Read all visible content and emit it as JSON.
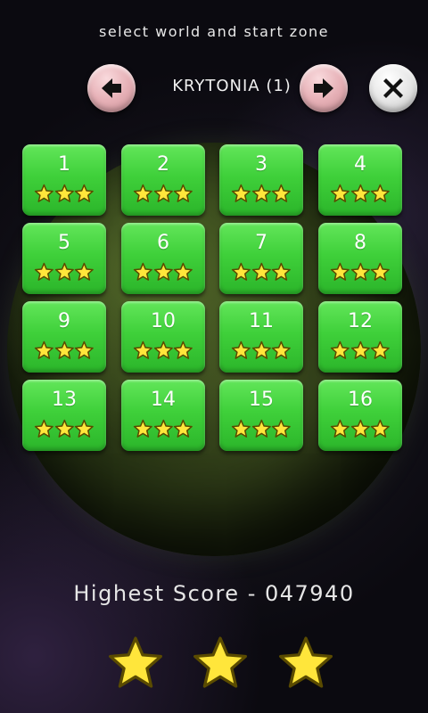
{
  "header": {
    "subtitle": "select world and start zone",
    "world_title": "KRYTONIA (1)",
    "prev_icon": "arrow-left-icon",
    "next_icon": "arrow-right-icon",
    "close_icon": "close-icon"
  },
  "zones": [
    {
      "number": "1",
      "stars": 3
    },
    {
      "number": "2",
      "stars": 3
    },
    {
      "number": "3",
      "stars": 3
    },
    {
      "number": "4",
      "stars": 3
    },
    {
      "number": "5",
      "stars": 3
    },
    {
      "number": "6",
      "stars": 3
    },
    {
      "number": "7",
      "stars": 3
    },
    {
      "number": "8",
      "stars": 3
    },
    {
      "number": "9",
      "stars": 3
    },
    {
      "number": "10",
      "stars": 3
    },
    {
      "number": "11",
      "stars": 3
    },
    {
      "number": "12",
      "stars": 3
    },
    {
      "number": "13",
      "stars": 3
    },
    {
      "number": "14",
      "stars": 3
    },
    {
      "number": "15",
      "stars": 3
    },
    {
      "number": "16",
      "stars": 3
    }
  ],
  "score": {
    "text": "Highest Score - 047940",
    "stars_earned": 3
  },
  "colors": {
    "zone_green": "#3fd03a",
    "star_yellow": "#ffe63b",
    "star_outline": "#5a4b00"
  }
}
